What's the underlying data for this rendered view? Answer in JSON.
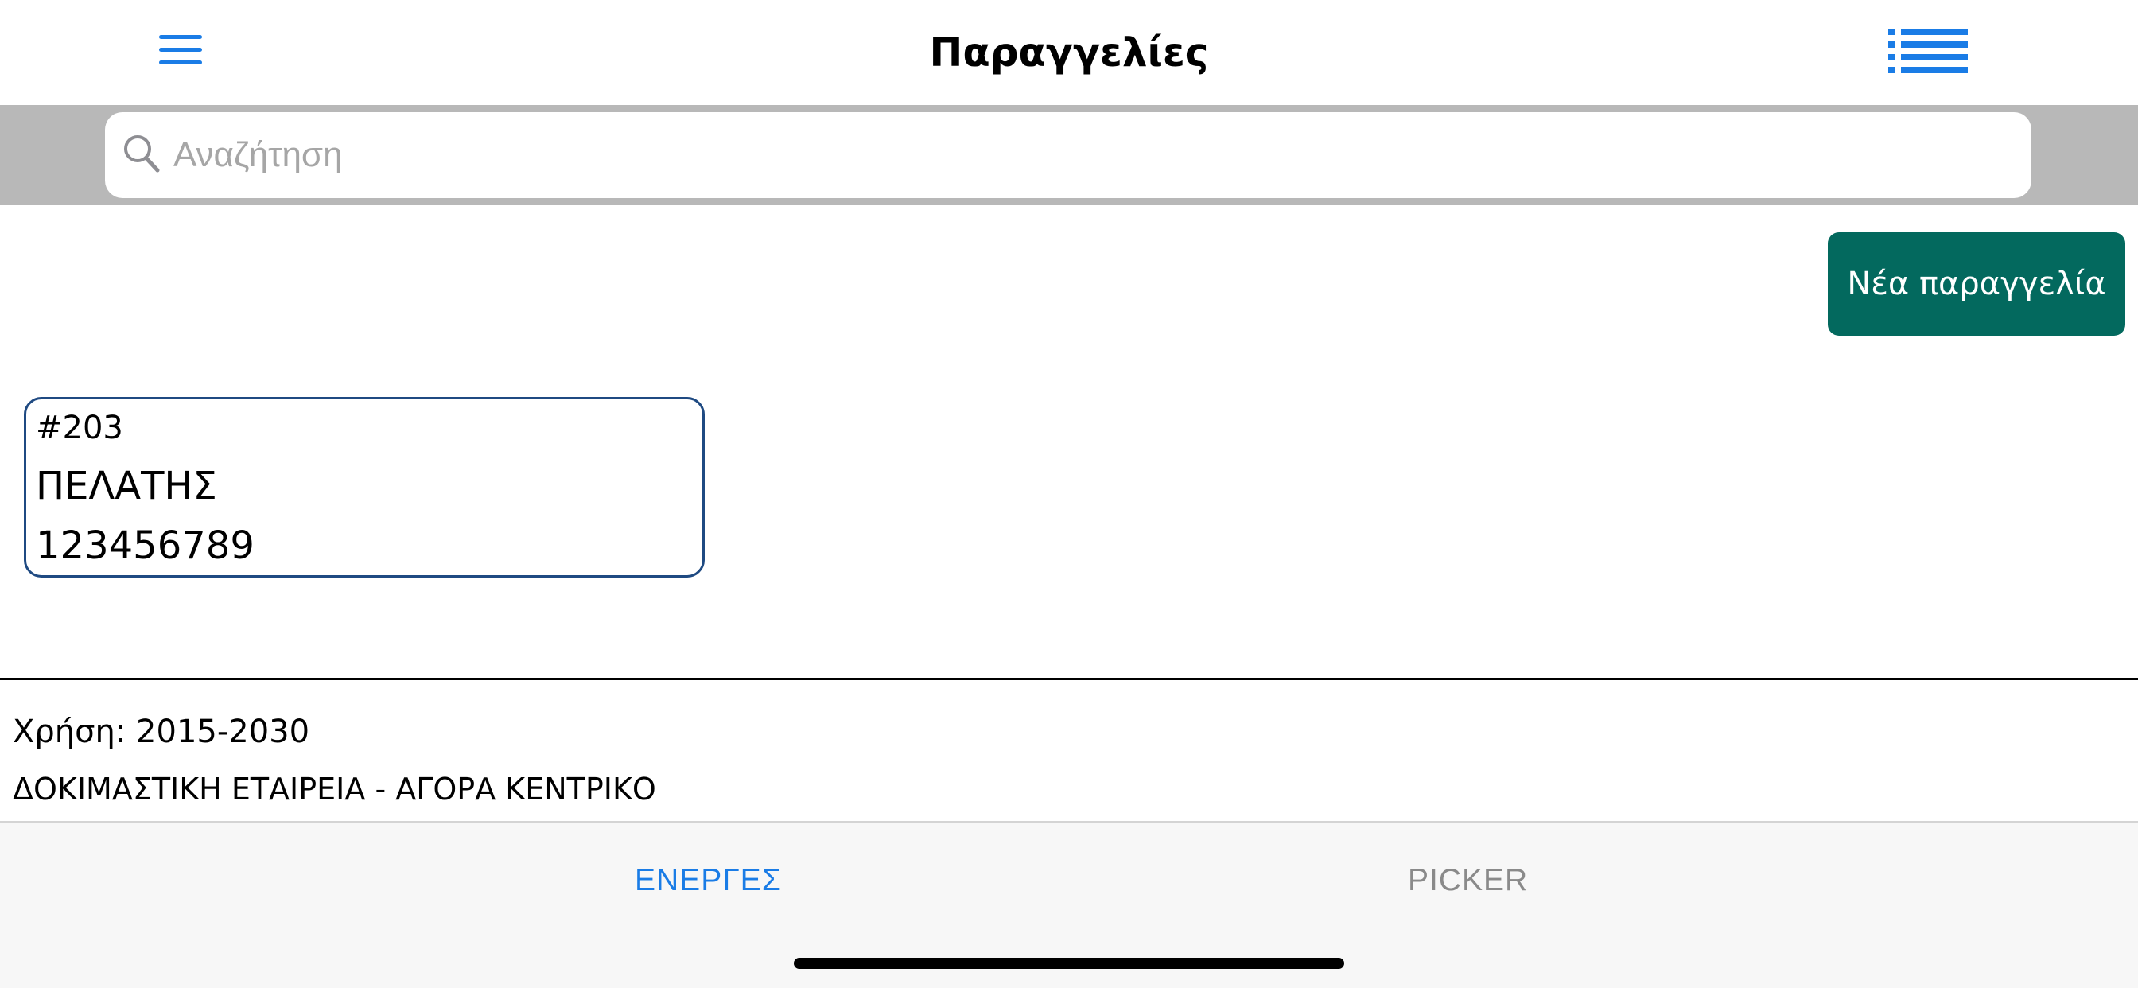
{
  "header": {
    "title": "Παραγγελίες",
    "menu_icon": "hamburger-menu-icon",
    "list_icon": "list-view-icon",
    "accent_color": "#1a7ce6"
  },
  "search": {
    "placeholder": "Αναζήτηση",
    "value": "",
    "icon": "search-icon"
  },
  "actions": {
    "new_order_label": "Νέα παραγγελία",
    "new_order_color": "#03695e"
  },
  "orders": [
    {
      "number": "#203",
      "customer": "ΠΕΛΑΤΗΣ",
      "phone": "123456789"
    }
  ],
  "footer": {
    "fiscal_year": "Χρήση: 2015-2030",
    "company": "ΔΟΚΙΜΑΣΤΙΚΗ ΕΤΑΙΡΕΙΑ - ΑΓΟΡΑ ΚΕΝΤΡΙΚΟ"
  },
  "tabs": [
    {
      "label": "ΕΝΕΡΓΕΣ",
      "active": true
    },
    {
      "label": "PICKER",
      "active": false
    }
  ]
}
